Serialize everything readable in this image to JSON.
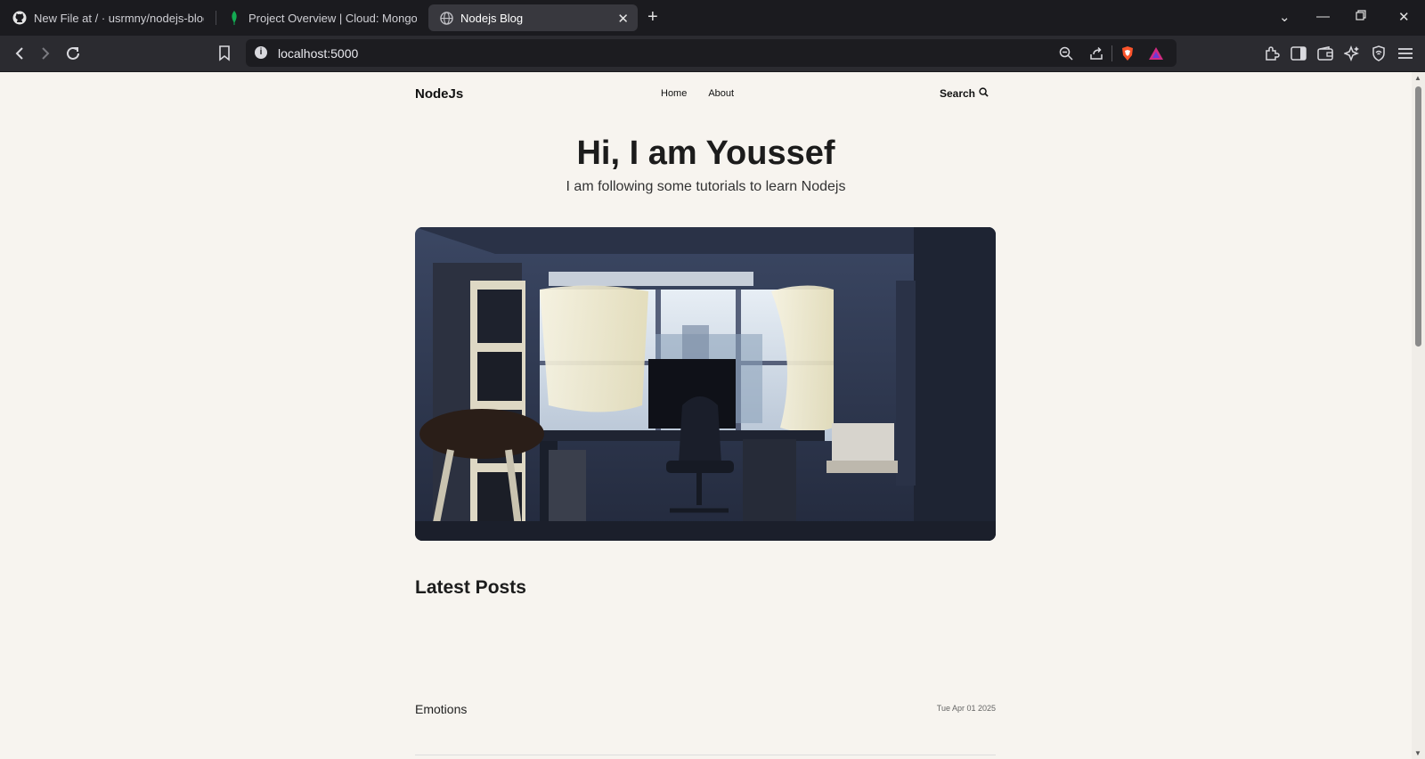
{
  "browser": {
    "tabs": [
      {
        "title": "New File at / · usrmny/nodejs-blog",
        "icon": "github-icon",
        "active": false
      },
      {
        "title": "Project Overview | Cloud: MongoDB",
        "icon": "mongodb-leaf-icon",
        "active": false
      },
      {
        "title": "Nodejs Blog",
        "icon": "globe-icon",
        "active": true
      }
    ],
    "url": "localhost:5000"
  },
  "site": {
    "logo": "NodeJs",
    "nav": [
      "Home",
      "About"
    ],
    "search_label": "Search"
  },
  "hero": {
    "title": "Hi, I am Youssef",
    "subtitle": "I am following some tutorials to learn Nodejs"
  },
  "latest": {
    "heading": "Latest Posts",
    "posts": [
      {
        "title": "Emotions",
        "date": "Tue Apr 01 2025"
      }
    ]
  },
  "colors": {
    "page_bg": "#f7f4ef",
    "chrome_bg": "#1b1b1f",
    "toolbar_bg": "#2b2b30"
  }
}
